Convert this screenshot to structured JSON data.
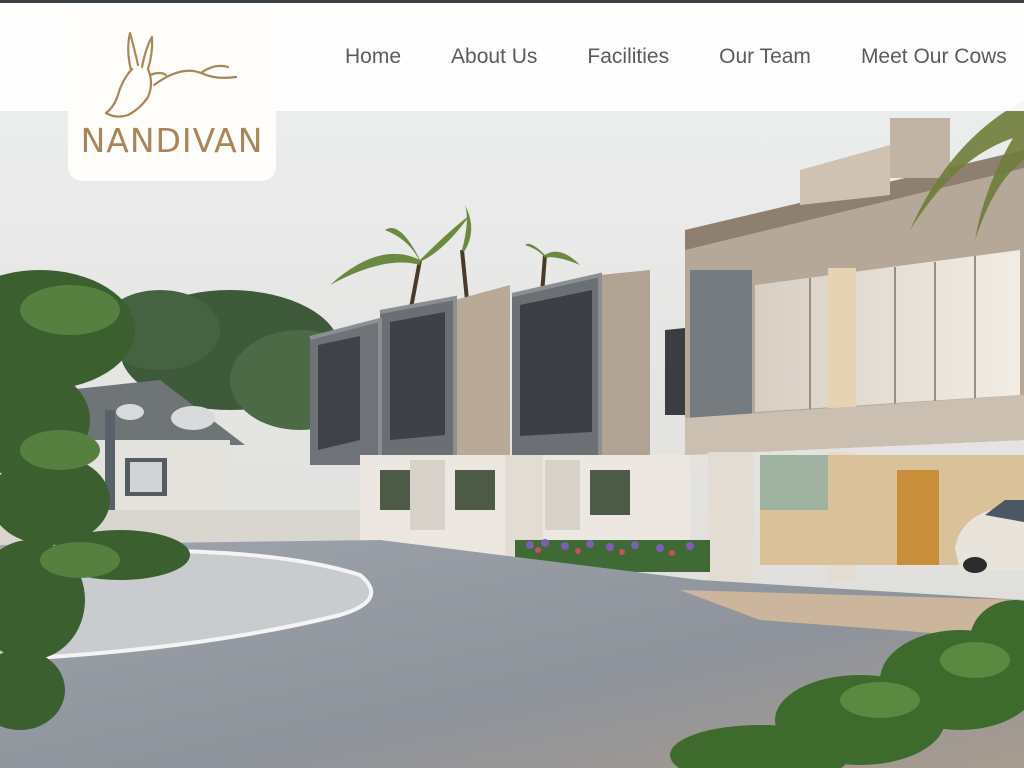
{
  "brand": {
    "name": "NANDIVAN",
    "logo_icon": "cow-line-art-icon",
    "color": "#a9865a"
  },
  "nav": {
    "items": [
      {
        "label": "Home"
      },
      {
        "label": "About Us"
      },
      {
        "label": "Facilities"
      },
      {
        "label": "Our Team"
      },
      {
        "label": "Meet Our Cows"
      }
    ]
  },
  "hero": {
    "image": "architectural rendering of a two-storey building with carport, palm trees and landscaped driveway"
  },
  "colors": {
    "header_bg": "#ffffff",
    "nav_text": "#5b5b5b",
    "top_strip": "#3a4048"
  }
}
